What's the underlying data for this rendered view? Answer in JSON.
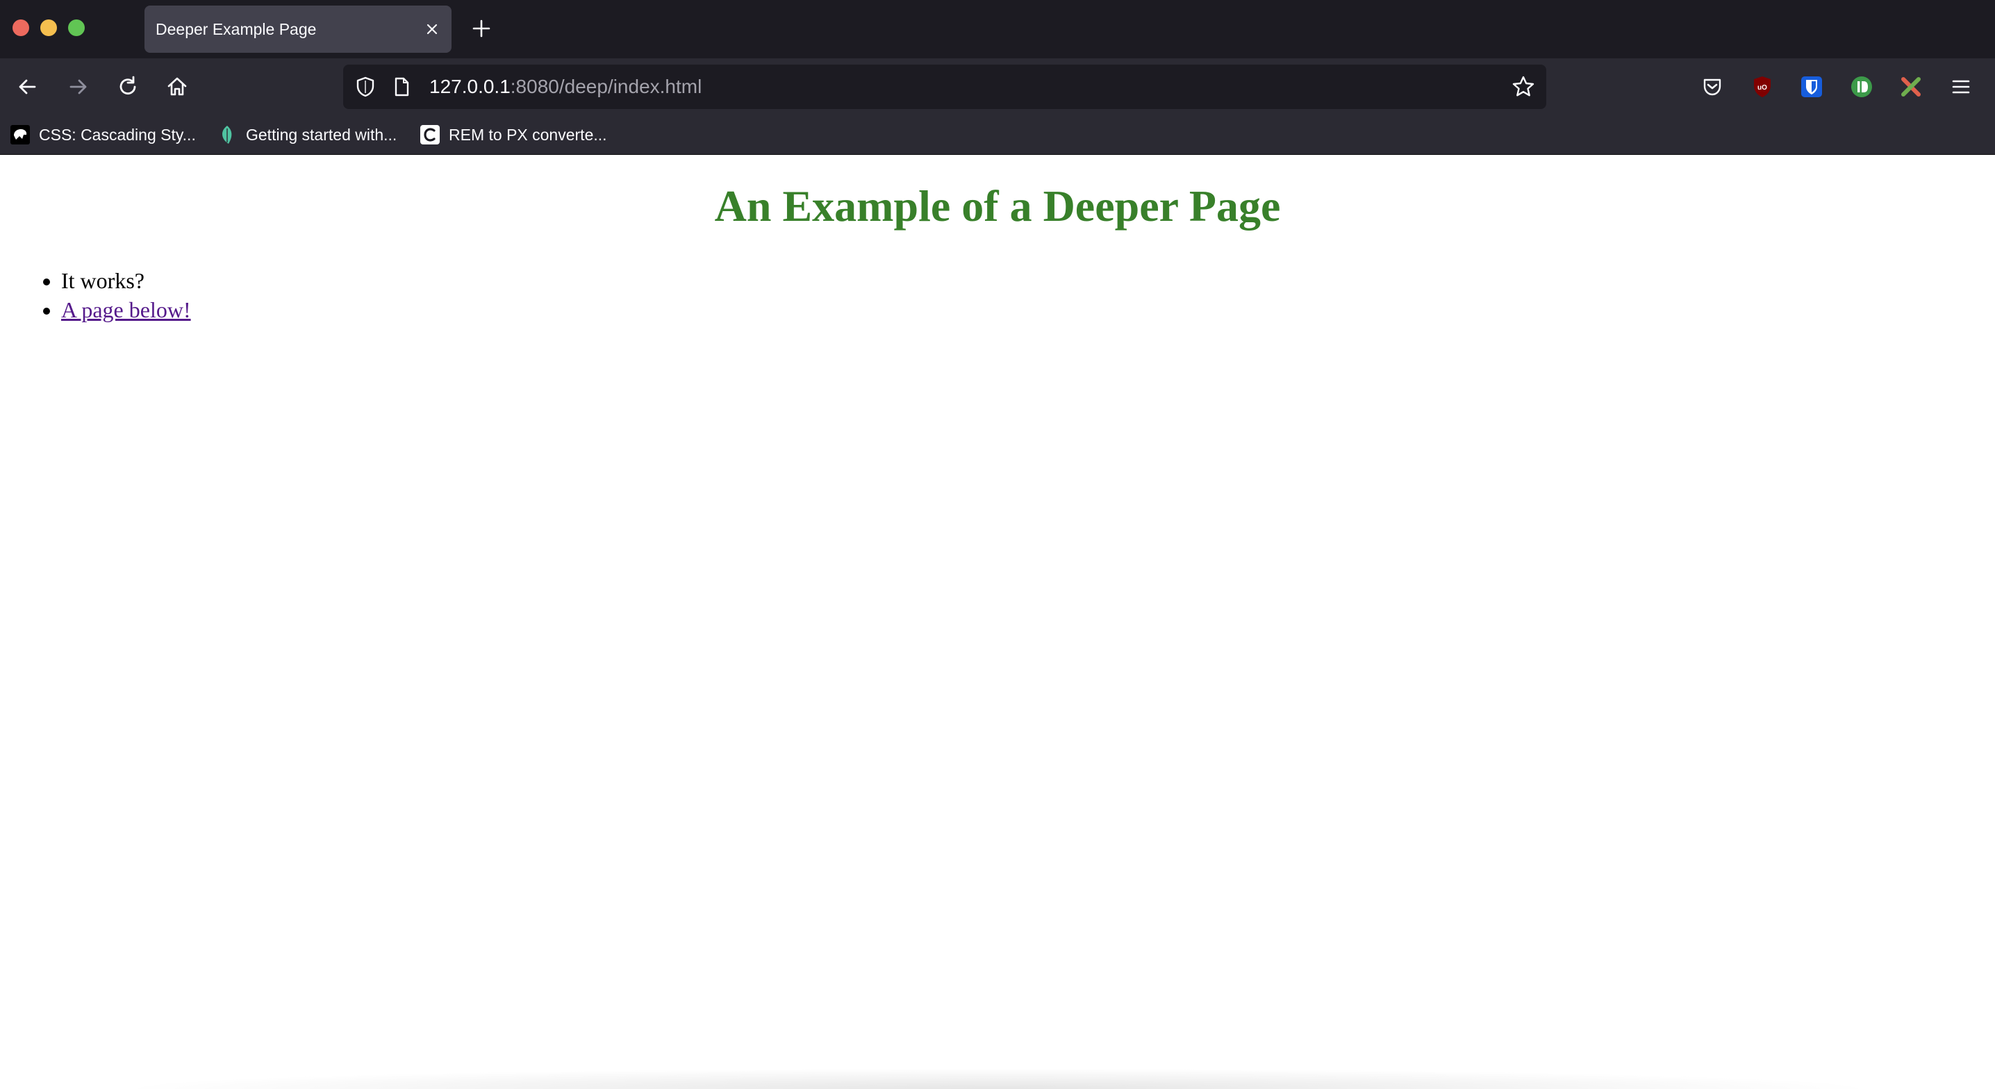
{
  "browser": {
    "tab": {
      "title": "Deeper Example Page"
    },
    "url": {
      "host": "127.0.0.1",
      "rest": ":8080/deep/index.html"
    },
    "bookmarks": [
      {
        "label": "CSS: Cascading Sty...",
        "icon": "mdn-icon"
      },
      {
        "label": "Getting started with...",
        "icon": "bookmark-leaf-icon"
      },
      {
        "label": "REM to PX converte...",
        "icon": "bookmark-c-icon"
      }
    ]
  },
  "page": {
    "title": "An Example of a Deeper Page",
    "items": [
      {
        "text": "It works?"
      },
      {
        "text": "A page below!"
      }
    ]
  },
  "colors": {
    "title_green": "#38802a",
    "link_purple": "#551a8b",
    "chrome_dark": "#1c1b22",
    "toolbar": "#2b2a33"
  }
}
